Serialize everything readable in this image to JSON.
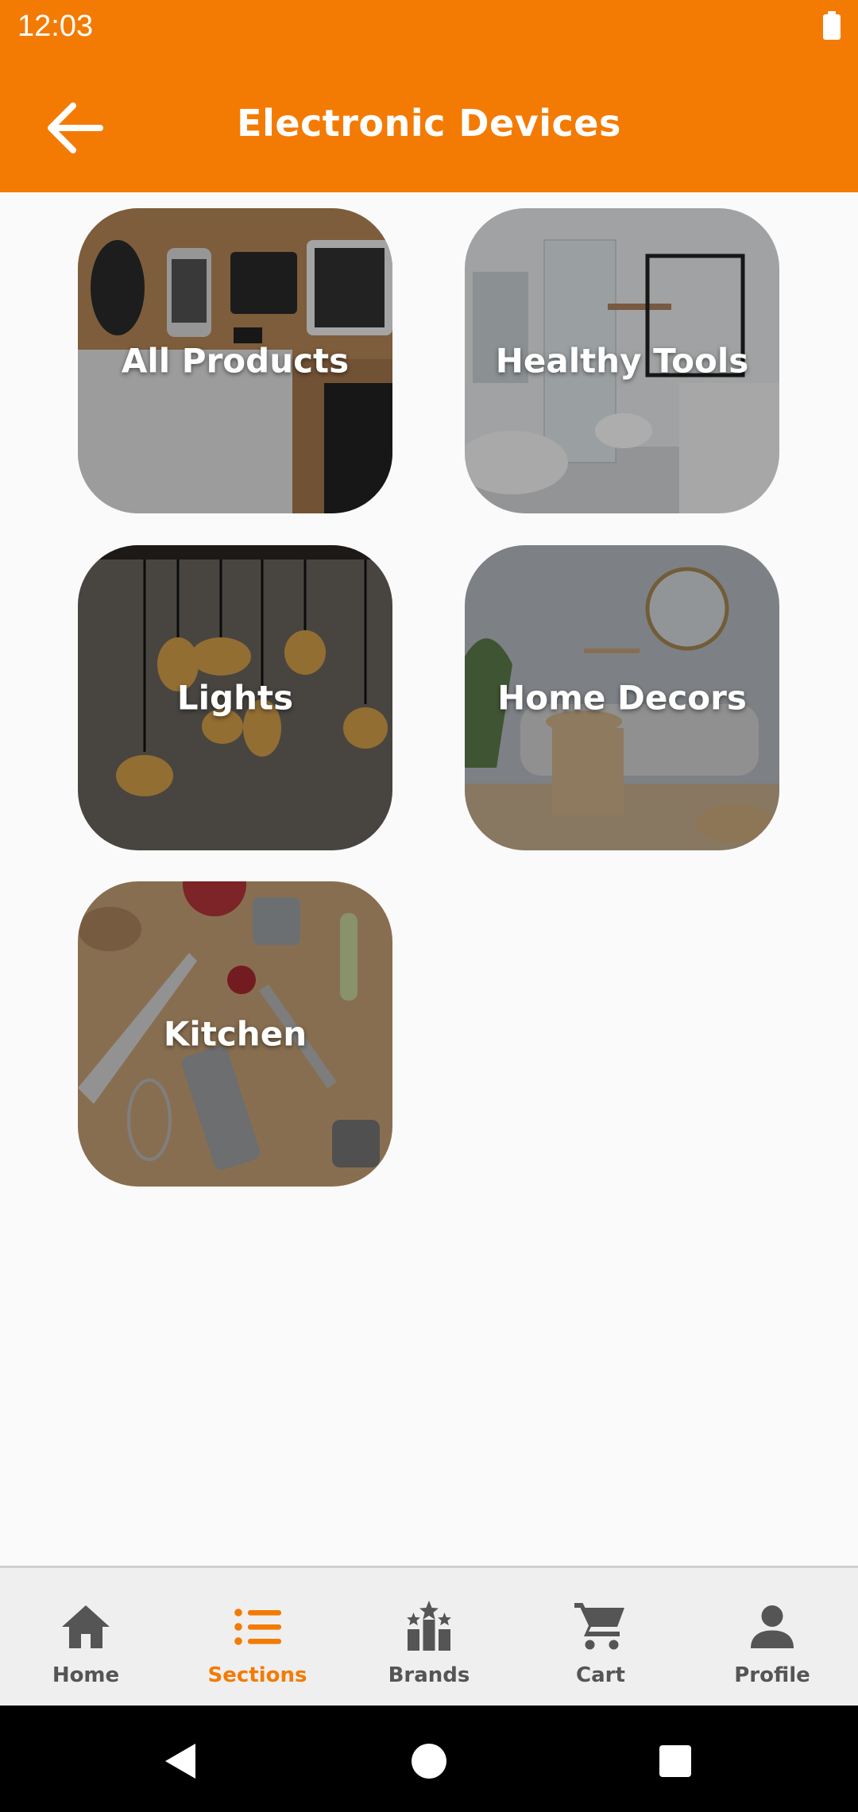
{
  "status_bar": {
    "time": "12:03"
  },
  "app_bar": {
    "title": "Electronic Devices"
  },
  "categories": [
    {
      "label": "All Products"
    },
    {
      "label": "Healthy Tools"
    },
    {
      "label": "Lights"
    },
    {
      "label": "Home Decors"
    },
    {
      "label": "Kitchen"
    }
  ],
  "bottom_nav": {
    "active": "Sections",
    "items": [
      {
        "label": "Home",
        "icon": "home-icon"
      },
      {
        "label": "Sections",
        "icon": "list-icon"
      },
      {
        "label": "Brands",
        "icon": "brands-icon"
      },
      {
        "label": "Cart",
        "icon": "cart-icon"
      },
      {
        "label": "Profile",
        "icon": "person-icon"
      }
    ]
  },
  "colors": {
    "accent": "#f37b04",
    "nav_inactive": "#555555",
    "nav_bg": "#efefef"
  }
}
